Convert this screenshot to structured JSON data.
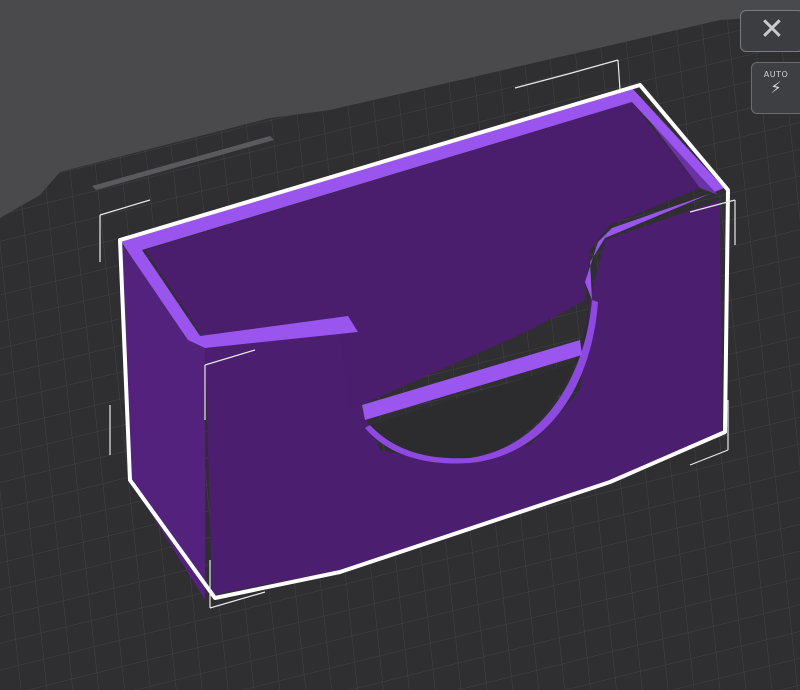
{
  "app": {
    "view": "3d-build-plate",
    "colors": {
      "background": "#4a4a4c",
      "plate": "#2e2e31",
      "grid": "#414145",
      "model_front": "#4d1f73",
      "model_side": "#5a2688",
      "model_top_rim": "#9a55ee",
      "selection_outline": "#ffffff"
    }
  },
  "toolbar": {
    "close_icon": "close-icon",
    "auto_label": "AUTO",
    "auto_icon": "auto-orient-icon"
  }
}
